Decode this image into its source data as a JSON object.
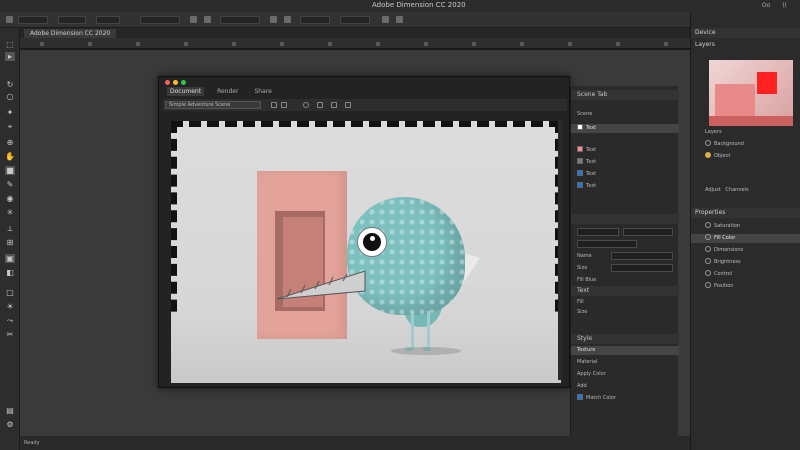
{
  "app": {
    "title": "Adobe Dimension CC 2020",
    "doc_tab": "Adobe Dimension CC 2020"
  },
  "window_controls": [
    "Oo",
    "(("
  ],
  "embedded_window": {
    "tabs": [
      "Document",
      "Render",
      "Share"
    ],
    "toolbar_select": "Simple Adventure Scene"
  },
  "scene_panel": {
    "title": "Scene Tab",
    "header": "Scene",
    "items": [
      {
        "label": "Text",
        "color": "#ffffff"
      },
      {
        "label": "Text",
        "color": "#ff8a8a"
      },
      {
        "label": "Text",
        "color": "#7d7d7d"
      },
      {
        "label": "Text",
        "color": "#1f7ad6"
      },
      {
        "label": "Text",
        "color": "#1f7ad6"
      }
    ]
  },
  "properties_panel": {
    "rows": [
      "Name",
      "Size",
      "Fill Blue"
    ],
    "text_section": "Text",
    "text_rows": [
      "Fill",
      "Size"
    ],
    "section": "Style",
    "section_rows": [
      "Texture",
      "Material",
      "Apply Color",
      "Add",
      "Match Color"
    ],
    "highlight_color": "#1f7ad6"
  },
  "right_panel": {
    "head": "Device",
    "head2": "Layers",
    "layers_head": "Layers",
    "layers": [
      "Background",
      "Object"
    ],
    "adjust_head": "Adjust",
    "adjust_tab": "Channels",
    "properties_head": "Properties",
    "properties": [
      "Saturation",
      "Fill Color",
      "Dimensions",
      "Brightness",
      "Control",
      "Position"
    ],
    "thumb_colors": {
      "accent": "#ff2020",
      "base": "#e88a8a"
    }
  },
  "status": {
    "text": "Ready"
  }
}
